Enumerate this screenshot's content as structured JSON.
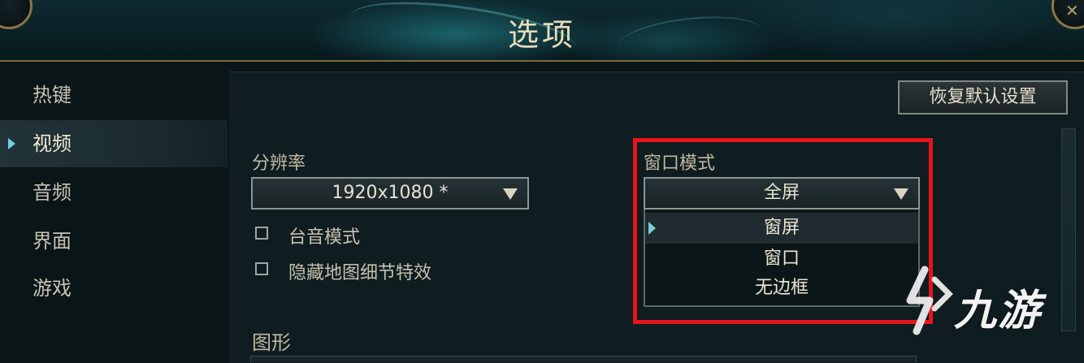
{
  "window": {
    "title": "选项"
  },
  "sidebar": {
    "items": [
      {
        "label": "热键"
      },
      {
        "label": "视频",
        "active": true
      },
      {
        "label": "音频"
      },
      {
        "label": "界面"
      },
      {
        "label": "游戏"
      }
    ]
  },
  "toolbar": {
    "reset_label": "恢复默认设置"
  },
  "resolution": {
    "label": "分辨率",
    "value": "1920x1080 *"
  },
  "checkboxes": [
    {
      "label": "台音模式",
      "checked": false
    },
    {
      "label": "隐藏地图细节特效",
      "checked": false
    }
  ],
  "window_mode": {
    "label": "窗口模式",
    "value": "全屏",
    "options": [
      "窗屏",
      "窗口",
      "无边框"
    ],
    "hovered_index": 0
  },
  "graphics": {
    "label": "图形"
  },
  "watermark": {
    "text": "九游"
  },
  "colors": {
    "accent": "#6fd2d6",
    "highlight": "#e4161b",
    "gold": "#8a7647"
  }
}
